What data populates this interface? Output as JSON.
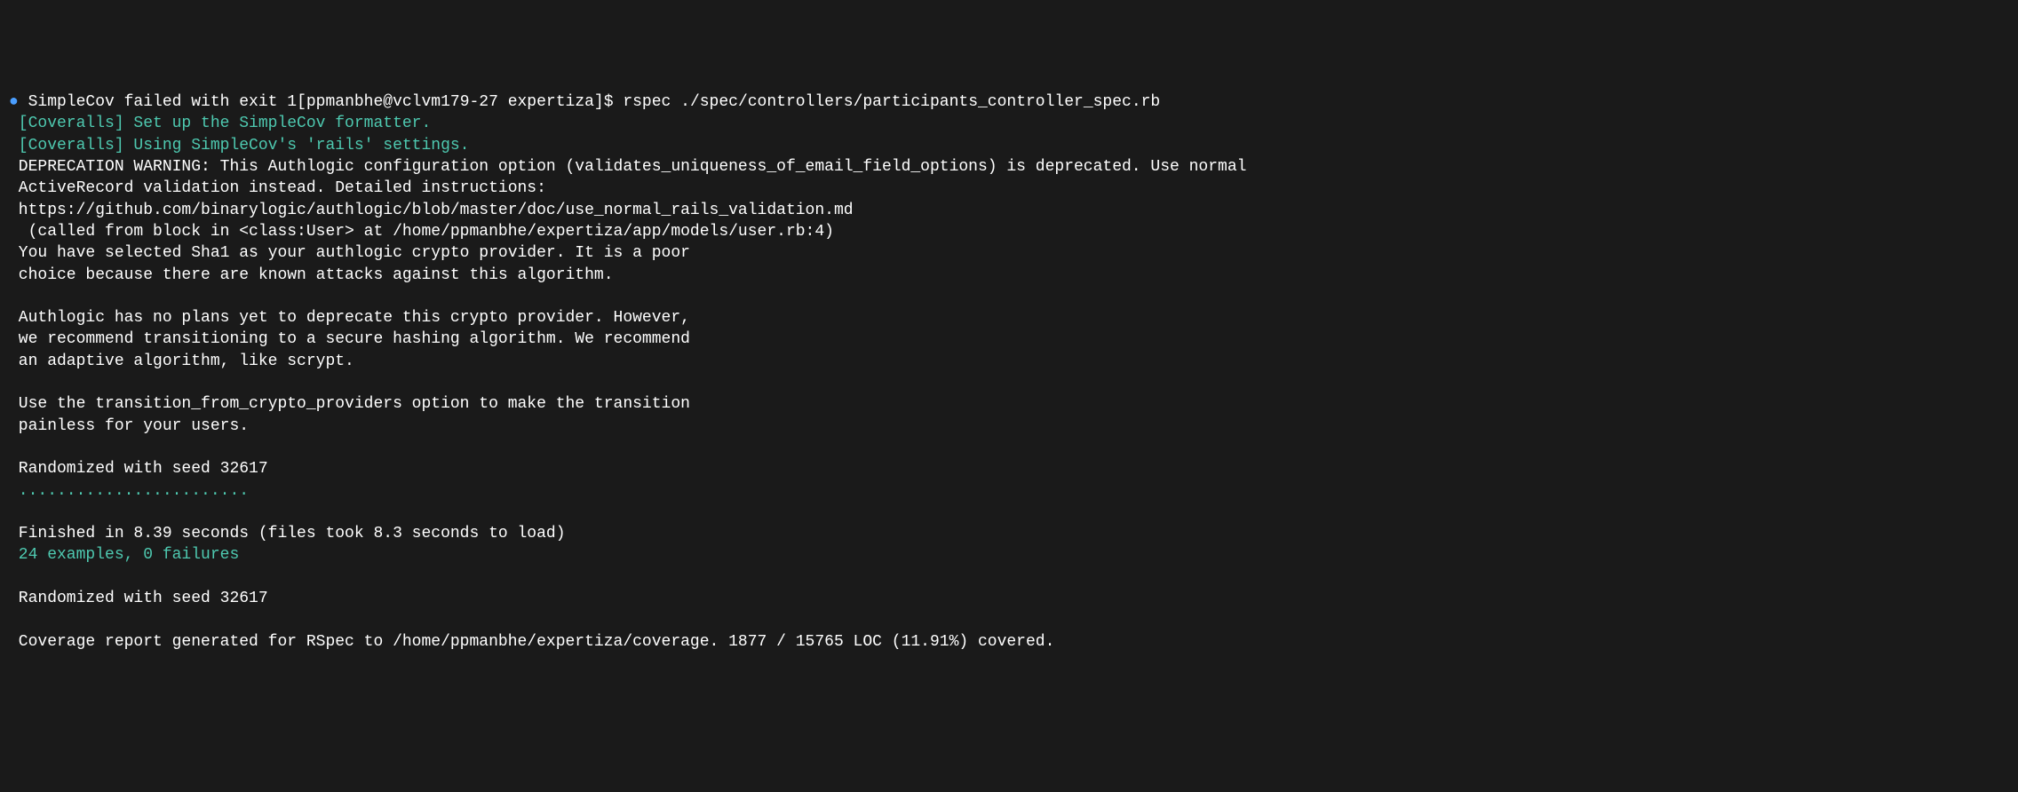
{
  "terminal": {
    "bullet": "●",
    "line1_prefix": " SimpleCov failed with exit 1[ppmanbhe@vclvm179-27 expertiza]$ ",
    "line1_cmd": "rspec ./spec/controllers/participants_controller_spec.rb",
    "line2": " [Coveralls] Set up the SimpleCov formatter.",
    "line3": " [Coveralls] Using SimpleCov's 'rails' settings.",
    "line4": " DEPRECATION WARNING: This Authlogic configuration option (validates_uniqueness_of_email_field_options) is deprecated. Use normal",
    "line5": " ActiveRecord validation instead. Detailed instructions:",
    "line6": " https://github.com/binarylogic/authlogic/blob/master/doc/use_normal_rails_validation.md",
    "line7": "  (called from block in <class:User> at /home/ppmanbhe/expertiza/app/models/user.rb:4)",
    "line8": " You have selected Sha1 as your authlogic crypto provider. It is a poor",
    "line9": " choice because there are known attacks against this algorithm.",
    "line10": " ",
    "line11": " Authlogic has no plans yet to deprecate this crypto provider. However,",
    "line12": " we recommend transitioning to a secure hashing algorithm. We recommend",
    "line13": " an adaptive algorithm, like scrypt.",
    "line14": " ",
    "line15": " Use the transition_from_crypto_providers option to make the transition",
    "line16": " painless for your users.",
    "line17": " ",
    "line18": " Randomized with seed 32617",
    "line19": " ........................",
    "line20": " ",
    "line21": " Finished in 8.39 seconds (files took 8.3 seconds to load)",
    "line22": " 24 examples, 0 failures",
    "line23": " ",
    "line24": " Randomized with seed 32617",
    "line25": " ",
    "line26": " Coverage report generated for RSpec to /home/ppmanbhe/expertiza/coverage. 1877 / 15765 LOC (11.91%) covered."
  }
}
